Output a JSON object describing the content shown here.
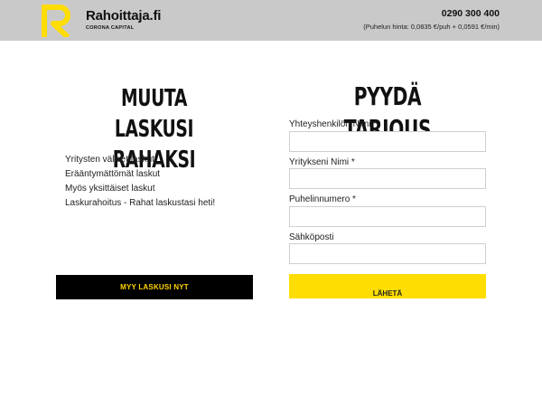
{
  "header": {
    "brand_name": "Rahoittaja.fi",
    "brand_sub": "CORONA CAPITAL",
    "logo_icon": "rahoittaja-r-logo-icon",
    "phone": "0290 300 400",
    "price_note": "(Puhelun hinta: 0,0835 €/puh + 0,0591 €/min)"
  },
  "left": {
    "heading_line1": "MUUTA LASKUSI",
    "heading_line2": "RAHAKSI",
    "features": [
      "Yritysten väliset laskut",
      "Erääntymättömät laskut",
      "Myös yksittäiset laskut",
      "Laskurahoitus - Rahat laskustasi heti!"
    ],
    "cta_label": "MYY LASKUSI NYT"
  },
  "form": {
    "heading": "PYYDÄ TARJOUS",
    "fields": [
      {
        "label": "Yhteyshenkilön Nimi *",
        "value": ""
      },
      {
        "label": "Yritykseni Nimi *",
        "value": ""
      },
      {
        "label": "Puhelinnumero *",
        "value": ""
      },
      {
        "label": "Sähköposti",
        "value": ""
      }
    ],
    "submit_label": "LÄHETÄ"
  },
  "colors": {
    "header_bg": "#c9c9c9",
    "accent_yellow": "#ffdd00",
    "button_black": "#000000"
  }
}
